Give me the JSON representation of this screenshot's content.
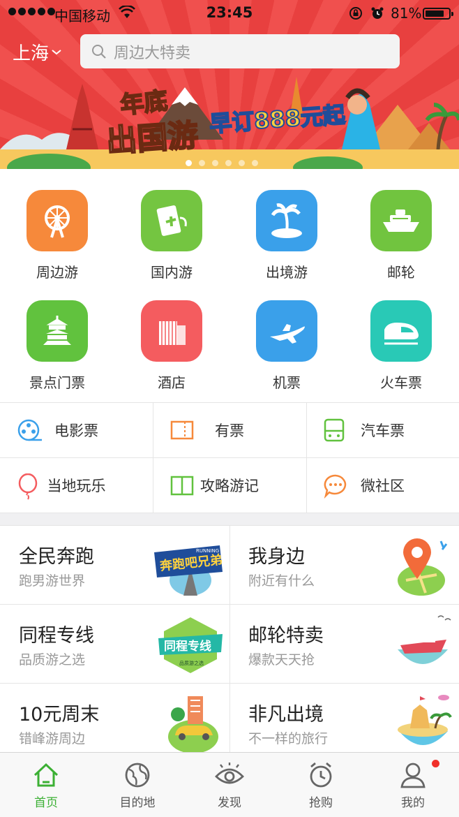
{
  "status_bar": {
    "carrier": "中国移动",
    "time": "23:45",
    "battery": "81%"
  },
  "header": {
    "city": "上海",
    "search_placeholder": "周边大特卖"
  },
  "banner": {
    "line1": "年底",
    "line2": "出国游",
    "line3": "早订888元起",
    "slides": 6,
    "active_slide": 1
  },
  "categories": [
    {
      "label": "周边游",
      "icon": "ferris-wheel-icon",
      "color": "#f6893b"
    },
    {
      "label": "国内游",
      "icon": "plane-ticket-icon",
      "color": "#74c541"
    },
    {
      "label": "出境游",
      "icon": "palm-island-icon",
      "color": "#3aa0ea"
    },
    {
      "label": "邮轮",
      "icon": "cruise-ship-icon",
      "color": "#71c43f"
    },
    {
      "label": "景点门票",
      "icon": "temple-icon",
      "color": "#61c23e"
    },
    {
      "label": "酒店",
      "icon": "hotel-building-icon",
      "color": "#f45c5f"
    },
    {
      "label": "机票",
      "icon": "airplane-icon",
      "color": "#3aa0ea"
    },
    {
      "label": "火车票",
      "icon": "bullet-train-icon",
      "color": "#29c9b6"
    }
  ],
  "quick_links": [
    {
      "label": "电影票",
      "icon": "film-reel-icon",
      "color": "#3aa0ea"
    },
    {
      "label": "有票",
      "icon": "ticket-icon",
      "color": "#f6893b"
    },
    {
      "label": "汽车票",
      "icon": "bus-icon",
      "color": "#61c23e"
    },
    {
      "label": "当地玩乐",
      "icon": "balloon-icon",
      "color": "#f45c5f"
    },
    {
      "label": "攻略游记",
      "icon": "book-icon",
      "color": "#61c23e"
    },
    {
      "label": "微社区",
      "icon": "chat-bubble-icon",
      "color": "#f6893b"
    }
  ],
  "promos": [
    {
      "title": "全民奔跑",
      "subtitle": "跑男游世界",
      "badge": "奔跑吧兄弟",
      "badge_sub": "RUNNING MAN"
    },
    {
      "title": "我身边",
      "subtitle": "附近有什么",
      "badge": "",
      "badge_sub": ""
    },
    {
      "title": "同程专线",
      "subtitle": "品质游之选",
      "badge": "同程专线",
      "badge_sub": "品质游之选"
    },
    {
      "title": "邮轮特卖",
      "subtitle": "爆款天天抢",
      "badge": "",
      "badge_sub": ""
    },
    {
      "title": "10元周末",
      "subtitle": "错峰游周边",
      "badge": "",
      "badge_sub": ""
    },
    {
      "title": "非凡出境",
      "subtitle": "不一样的旅行",
      "badge": "",
      "badge_sub": ""
    }
  ],
  "tabs": [
    {
      "label": "首页",
      "icon": "home-icon",
      "active": true
    },
    {
      "label": "目的地",
      "icon": "globe-icon",
      "active": false
    },
    {
      "label": "发现",
      "icon": "eye-icon",
      "active": false
    },
    {
      "label": "抢购",
      "icon": "alarm-clock-icon",
      "active": false
    },
    {
      "label": "我的",
      "icon": "user-icon",
      "active": false,
      "notification": true
    }
  ],
  "colors": {
    "accent": "#3cb034",
    "hero": "#f0504e",
    "notify": "#f0302a"
  }
}
